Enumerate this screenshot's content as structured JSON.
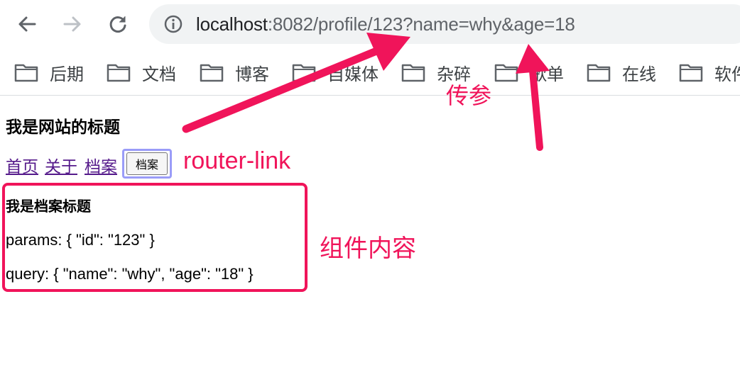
{
  "browser": {
    "url_host": "localhost",
    "url_rest": ":8082/profile/123?name=why&age=18",
    "bookmarks": [
      {
        "label": "后期"
      },
      {
        "label": "文档"
      },
      {
        "label": "博客"
      },
      {
        "label": "自媒体"
      },
      {
        "label": "杂碎"
      },
      {
        "label": "歌单"
      },
      {
        "label": "在线"
      },
      {
        "label": "软件"
      }
    ]
  },
  "page": {
    "title": "我是网站的标题",
    "nav": {
      "home": "首页",
      "about": "关于",
      "archive": "档案",
      "archive_button": "档案"
    },
    "component": {
      "title": "我是档案标题",
      "params_line": "params: { \"id\": \"123\" }",
      "query_line": "query: { \"name\": \"why\", \"age\": \"18\" }"
    }
  },
  "annotations": {
    "pass_params": "传参",
    "router_link": "router-link",
    "component_content": "组件内容",
    "color": "#f0145a"
  },
  "icons": [
    "back-arrow-icon",
    "forward-arrow-icon",
    "reload-icon",
    "info-icon",
    "folder-icon"
  ]
}
